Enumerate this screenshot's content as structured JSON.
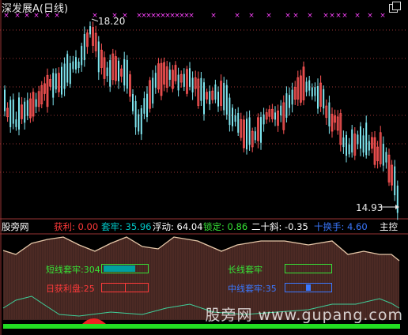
{
  "title": "深发展A(日线)",
  "price_labels": {
    "high": "18.20",
    "low": "14.93"
  },
  "indicator_bar": {
    "name": "股旁网",
    "items": [
      {
        "label": "获利:",
        "value": "0.00",
        "color": "#ff3a3a"
      },
      {
        "label": "套牢:",
        "value": "35.96",
        "color": "#00c8c8"
      },
      {
        "label": "浮动:",
        "value": "64.04",
        "color": "#ffffff"
      },
      {
        "label": "锁定:",
        "value": "0.86",
        "color": "#36e336"
      },
      {
        "label": "二十斜:",
        "value": "-0.35",
        "color": "#ffffff"
      },
      {
        "label": "十换手:",
        "value": "4.60",
        "color": "#3a78ff"
      }
    ],
    "suffix": "主控"
  },
  "panel_labels": {
    "short_trap": "短线套牢:304",
    "long_trap": "长线套牢",
    "day_profit": "日获利盘:25",
    "mid_trap": "中线套牢:35"
  },
  "watermark": "股旁网 www.gupang.com",
  "colors": {
    "bull": "#ff5555",
    "bear": "#7fe6f0",
    "cross": "#ff44ff",
    "grid": "#993333",
    "lower_line": "#e6c7a8",
    "lower_line2": "#3fd09a",
    "bottom_bar": "#22dd22",
    "mound": "#ee2222"
  }
}
